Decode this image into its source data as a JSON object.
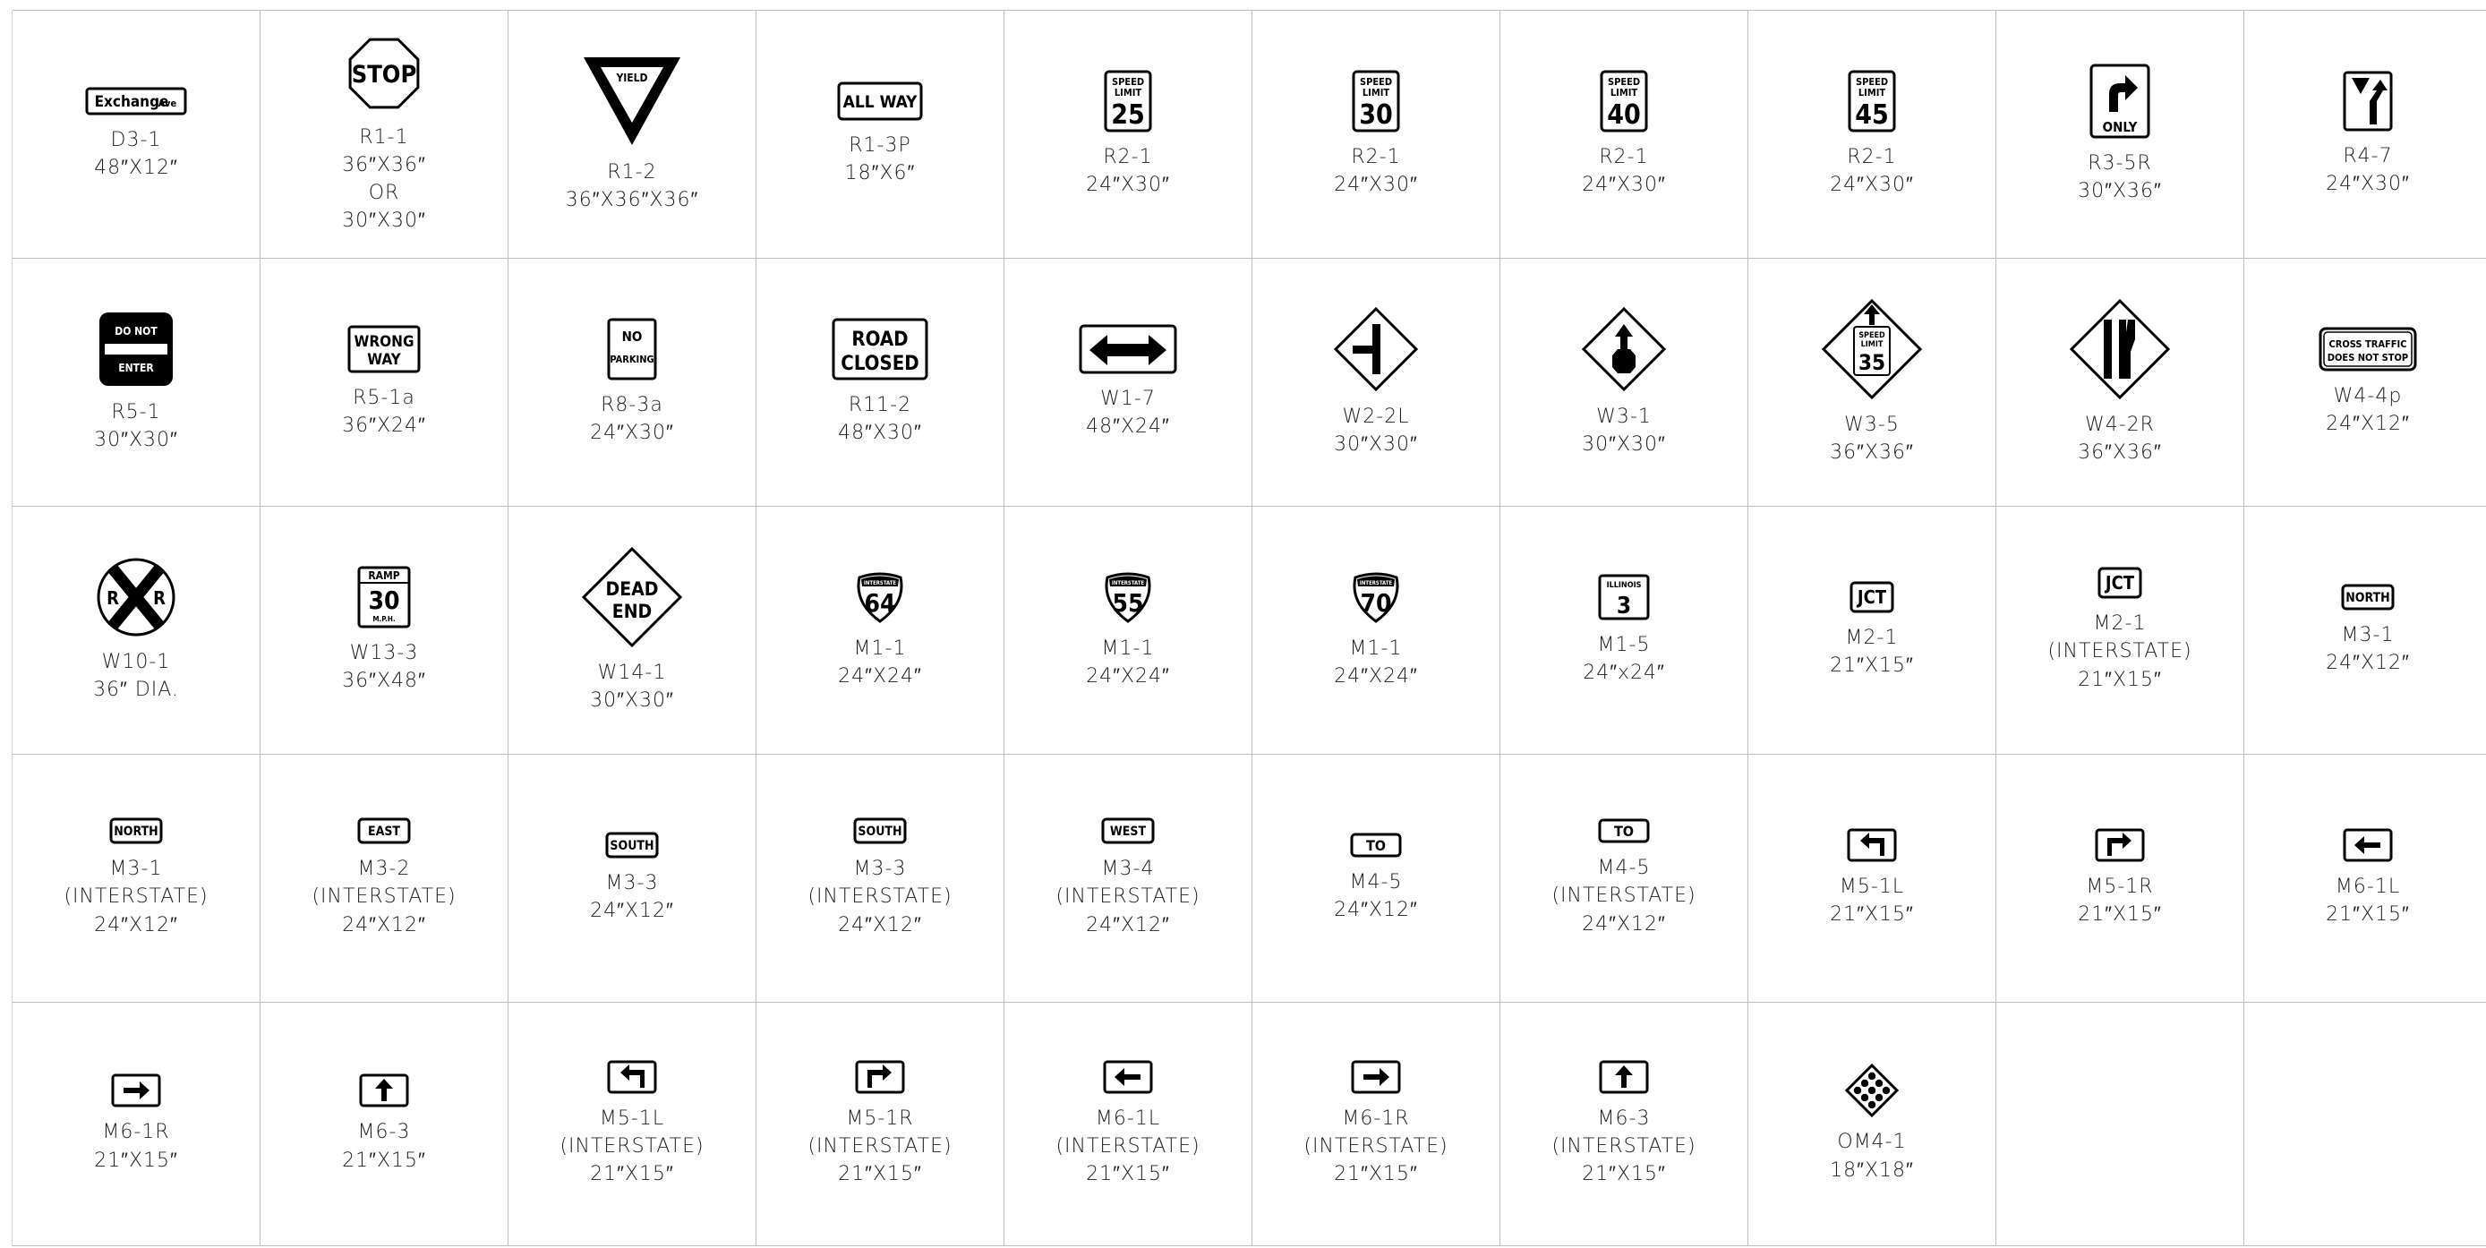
{
  "sheet": {
    "signs": [
      {
        "id": "D3-1",
        "lines": [
          "48″X12″"
        ],
        "icon": "street-name-sign",
        "text": [
          "Exchange",
          "Ave"
        ]
      },
      {
        "id": "R1-1",
        "lines": [
          "36″X36″",
          "OR",
          "30″X30″"
        ],
        "icon": "stop-sign",
        "text": [
          "STOP"
        ]
      },
      {
        "id": "R1-2",
        "lines": [
          "36″X36″X36″"
        ],
        "icon": "yield-sign",
        "text": [
          "YIELD"
        ]
      },
      {
        "id": "R1-3P",
        "lines": [
          "18″X6″"
        ],
        "icon": "all-way-plaque",
        "text": [
          "ALL WAY"
        ]
      },
      {
        "id": "R2-1",
        "lines": [
          "24″X30″"
        ],
        "icon": "speed-limit-sign",
        "text": [
          "SPEED",
          "LIMIT",
          "25"
        ]
      },
      {
        "id": "R2-1",
        "lines": [
          "24″X30″"
        ],
        "icon": "speed-limit-sign",
        "text": [
          "SPEED",
          "LIMIT",
          "30"
        ]
      },
      {
        "id": "R2-1",
        "lines": [
          "24″X30″"
        ],
        "icon": "speed-limit-sign",
        "text": [
          "SPEED",
          "LIMIT",
          "40"
        ]
      },
      {
        "id": "R2-1",
        "lines": [
          "24″X30″"
        ],
        "icon": "speed-limit-sign",
        "text": [
          "SPEED",
          "LIMIT",
          "45"
        ]
      },
      {
        "id": "R3-5R",
        "lines": [
          "30″X36″"
        ],
        "icon": "right-turn-only-sign",
        "text": [
          "ONLY"
        ]
      },
      {
        "id": "R4-7",
        "lines": [
          "24″X30″"
        ],
        "icon": "keep-right-sign",
        "text": []
      },
      {
        "id": "R5-1",
        "lines": [
          "30″X30″"
        ],
        "icon": "do-not-enter-sign",
        "text": [
          "DO NOT",
          "ENTER"
        ]
      },
      {
        "id": "R5-1a",
        "lines": [
          "36″X24″"
        ],
        "icon": "wrong-way-sign",
        "text": [
          "WRONG",
          "WAY"
        ]
      },
      {
        "id": "R8-3a",
        "lines": [
          "24″X30″"
        ],
        "icon": "no-parking-sign",
        "text": [
          "NO",
          "PARKING"
        ]
      },
      {
        "id": "R11-2",
        "lines": [
          "48″X30″"
        ],
        "icon": "road-closed-sign",
        "text": [
          "ROAD",
          "CLOSED"
        ]
      },
      {
        "id": "W1-7",
        "lines": [
          "48″X24″"
        ],
        "icon": "double-arrow-sign",
        "text": []
      },
      {
        "id": "W2-2L",
        "lines": [
          "30″X30″"
        ],
        "icon": "side-road-sign",
        "text": []
      },
      {
        "id": "W3-1",
        "lines": [
          "30″X30″"
        ],
        "icon": "stop-ahead-sign",
        "text": []
      },
      {
        "id": "W3-5",
        "lines": [
          "36″X36″"
        ],
        "icon": "reduced-speed-ahead-sign",
        "text": [
          "SPEED",
          "LIMIT",
          "35"
        ]
      },
      {
        "id": "W4-2R",
        "lines": [
          "36″X36″"
        ],
        "icon": "lane-ends-sign",
        "text": []
      },
      {
        "id": "W4-4p",
        "lines": [
          "24″X12″"
        ],
        "icon": "cross-traffic-plaque",
        "text": [
          "CROSS TRAFFIC",
          "DOES NOT STOP"
        ]
      },
      {
        "id": "W10-1",
        "lines": [
          "36″ DIA."
        ],
        "icon": "railroad-crossing-sign",
        "text": [
          "R",
          "R"
        ]
      },
      {
        "id": "W13-3",
        "lines": [
          "36″X48″"
        ],
        "icon": "ramp-speed-sign",
        "text": [
          "RAMP",
          "30",
          "M.P.H."
        ]
      },
      {
        "id": "W14-1",
        "lines": [
          "30″X30″"
        ],
        "icon": "dead-end-sign",
        "text": [
          "DEAD",
          "END"
        ]
      },
      {
        "id": "M1-1",
        "lines": [
          "24″X24″"
        ],
        "icon": "interstate-shield",
        "text": [
          "INTERSTATE",
          "64"
        ]
      },
      {
        "id": "M1-1",
        "lines": [
          "24″X24″"
        ],
        "icon": "interstate-shield",
        "text": [
          "INTERSTATE",
          "55"
        ]
      },
      {
        "id": "M1-1",
        "lines": [
          "24″X24″"
        ],
        "icon": "interstate-shield",
        "text": [
          "INTERSTATE",
          "70"
        ]
      },
      {
        "id": "M1-5",
        "lines": [
          "24″x24″"
        ],
        "icon": "state-route-sign",
        "text": [
          "ILLINOIS",
          "3"
        ]
      },
      {
        "id": "M2-1",
        "lines": [
          "21″X15″"
        ],
        "icon": "jct-plaque",
        "text": [
          "JCT"
        ]
      },
      {
        "id": "M2-1",
        "lines": [
          "(INTERSTATE)",
          "21″X15″"
        ],
        "icon": "jct-plaque",
        "text": [
          "JCT"
        ]
      },
      {
        "id": "M3-1",
        "lines": [
          "24″X12″"
        ],
        "icon": "cardinal-plaque",
        "text": [
          "NORTH"
        ]
      },
      {
        "id": "M3-1",
        "lines": [
          "(INTERSTATE)",
          "24″X12″"
        ],
        "icon": "cardinal-plaque",
        "text": [
          "NORTH"
        ]
      },
      {
        "id": "M3-2",
        "lines": [
          "(INTERSTATE)",
          "24″X12″"
        ],
        "icon": "cardinal-plaque",
        "text": [
          "EAST"
        ]
      },
      {
        "id": "M3-3",
        "lines": [
          "24″X12″"
        ],
        "icon": "cardinal-plaque",
        "text": [
          "SOUTH"
        ]
      },
      {
        "id": "M3-3",
        "lines": [
          "(INTERSTATE)",
          "24″X12″"
        ],
        "icon": "cardinal-plaque",
        "text": [
          "SOUTH"
        ]
      },
      {
        "id": "M3-4",
        "lines": [
          "(INTERSTATE)",
          "24″X12″"
        ],
        "icon": "cardinal-plaque",
        "text": [
          "WEST"
        ]
      },
      {
        "id": "M4-5",
        "lines": [
          "24″X12″"
        ],
        "icon": "to-plaque",
        "text": [
          "TO"
        ]
      },
      {
        "id": "M4-5",
        "lines": [
          "(INTERSTATE)",
          "24″X12″"
        ],
        "icon": "to-plaque",
        "text": [
          "TO"
        ]
      },
      {
        "id": "M5-1L",
        "lines": [
          "21″X15″"
        ],
        "icon": "turn-left-arrow-plaque",
        "text": []
      },
      {
        "id": "M5-1R",
        "lines": [
          "21″X15″"
        ],
        "icon": "turn-right-arrow-plaque",
        "text": []
      },
      {
        "id": "M6-1L",
        "lines": [
          "21″X15″"
        ],
        "icon": "left-arrow-plaque",
        "text": []
      },
      {
        "id": "M6-1R",
        "lines": [
          "21″X15″"
        ],
        "icon": "right-arrow-plaque",
        "text": []
      },
      {
        "id": "M6-3",
        "lines": [
          "21″X15″"
        ],
        "icon": "up-arrow-plaque",
        "text": []
      },
      {
        "id": "M5-1L",
        "lines": [
          "(INTERSTATE)",
          "21″X15″"
        ],
        "icon": "turn-left-arrow-plaque",
        "text": []
      },
      {
        "id": "M5-1R",
        "lines": [
          "(INTERSTATE)",
          "21″X15″"
        ],
        "icon": "turn-right-arrow-plaque",
        "text": []
      },
      {
        "id": "M6-1L",
        "lines": [
          "(INTERSTATE)",
          "21″X15″"
        ],
        "icon": "left-arrow-plaque",
        "text": []
      },
      {
        "id": "M6-1R",
        "lines": [
          "(INTERSTATE)",
          "21″X15″"
        ],
        "icon": "right-arrow-plaque",
        "text": []
      },
      {
        "id": "M6-3",
        "lines": [
          "(INTERSTATE)",
          "21″X15″"
        ],
        "icon": "up-arrow-plaque",
        "text": []
      },
      {
        "id": "OM4-1",
        "lines": [
          "18″X18″"
        ],
        "icon": "object-marker",
        "text": []
      }
    ]
  }
}
